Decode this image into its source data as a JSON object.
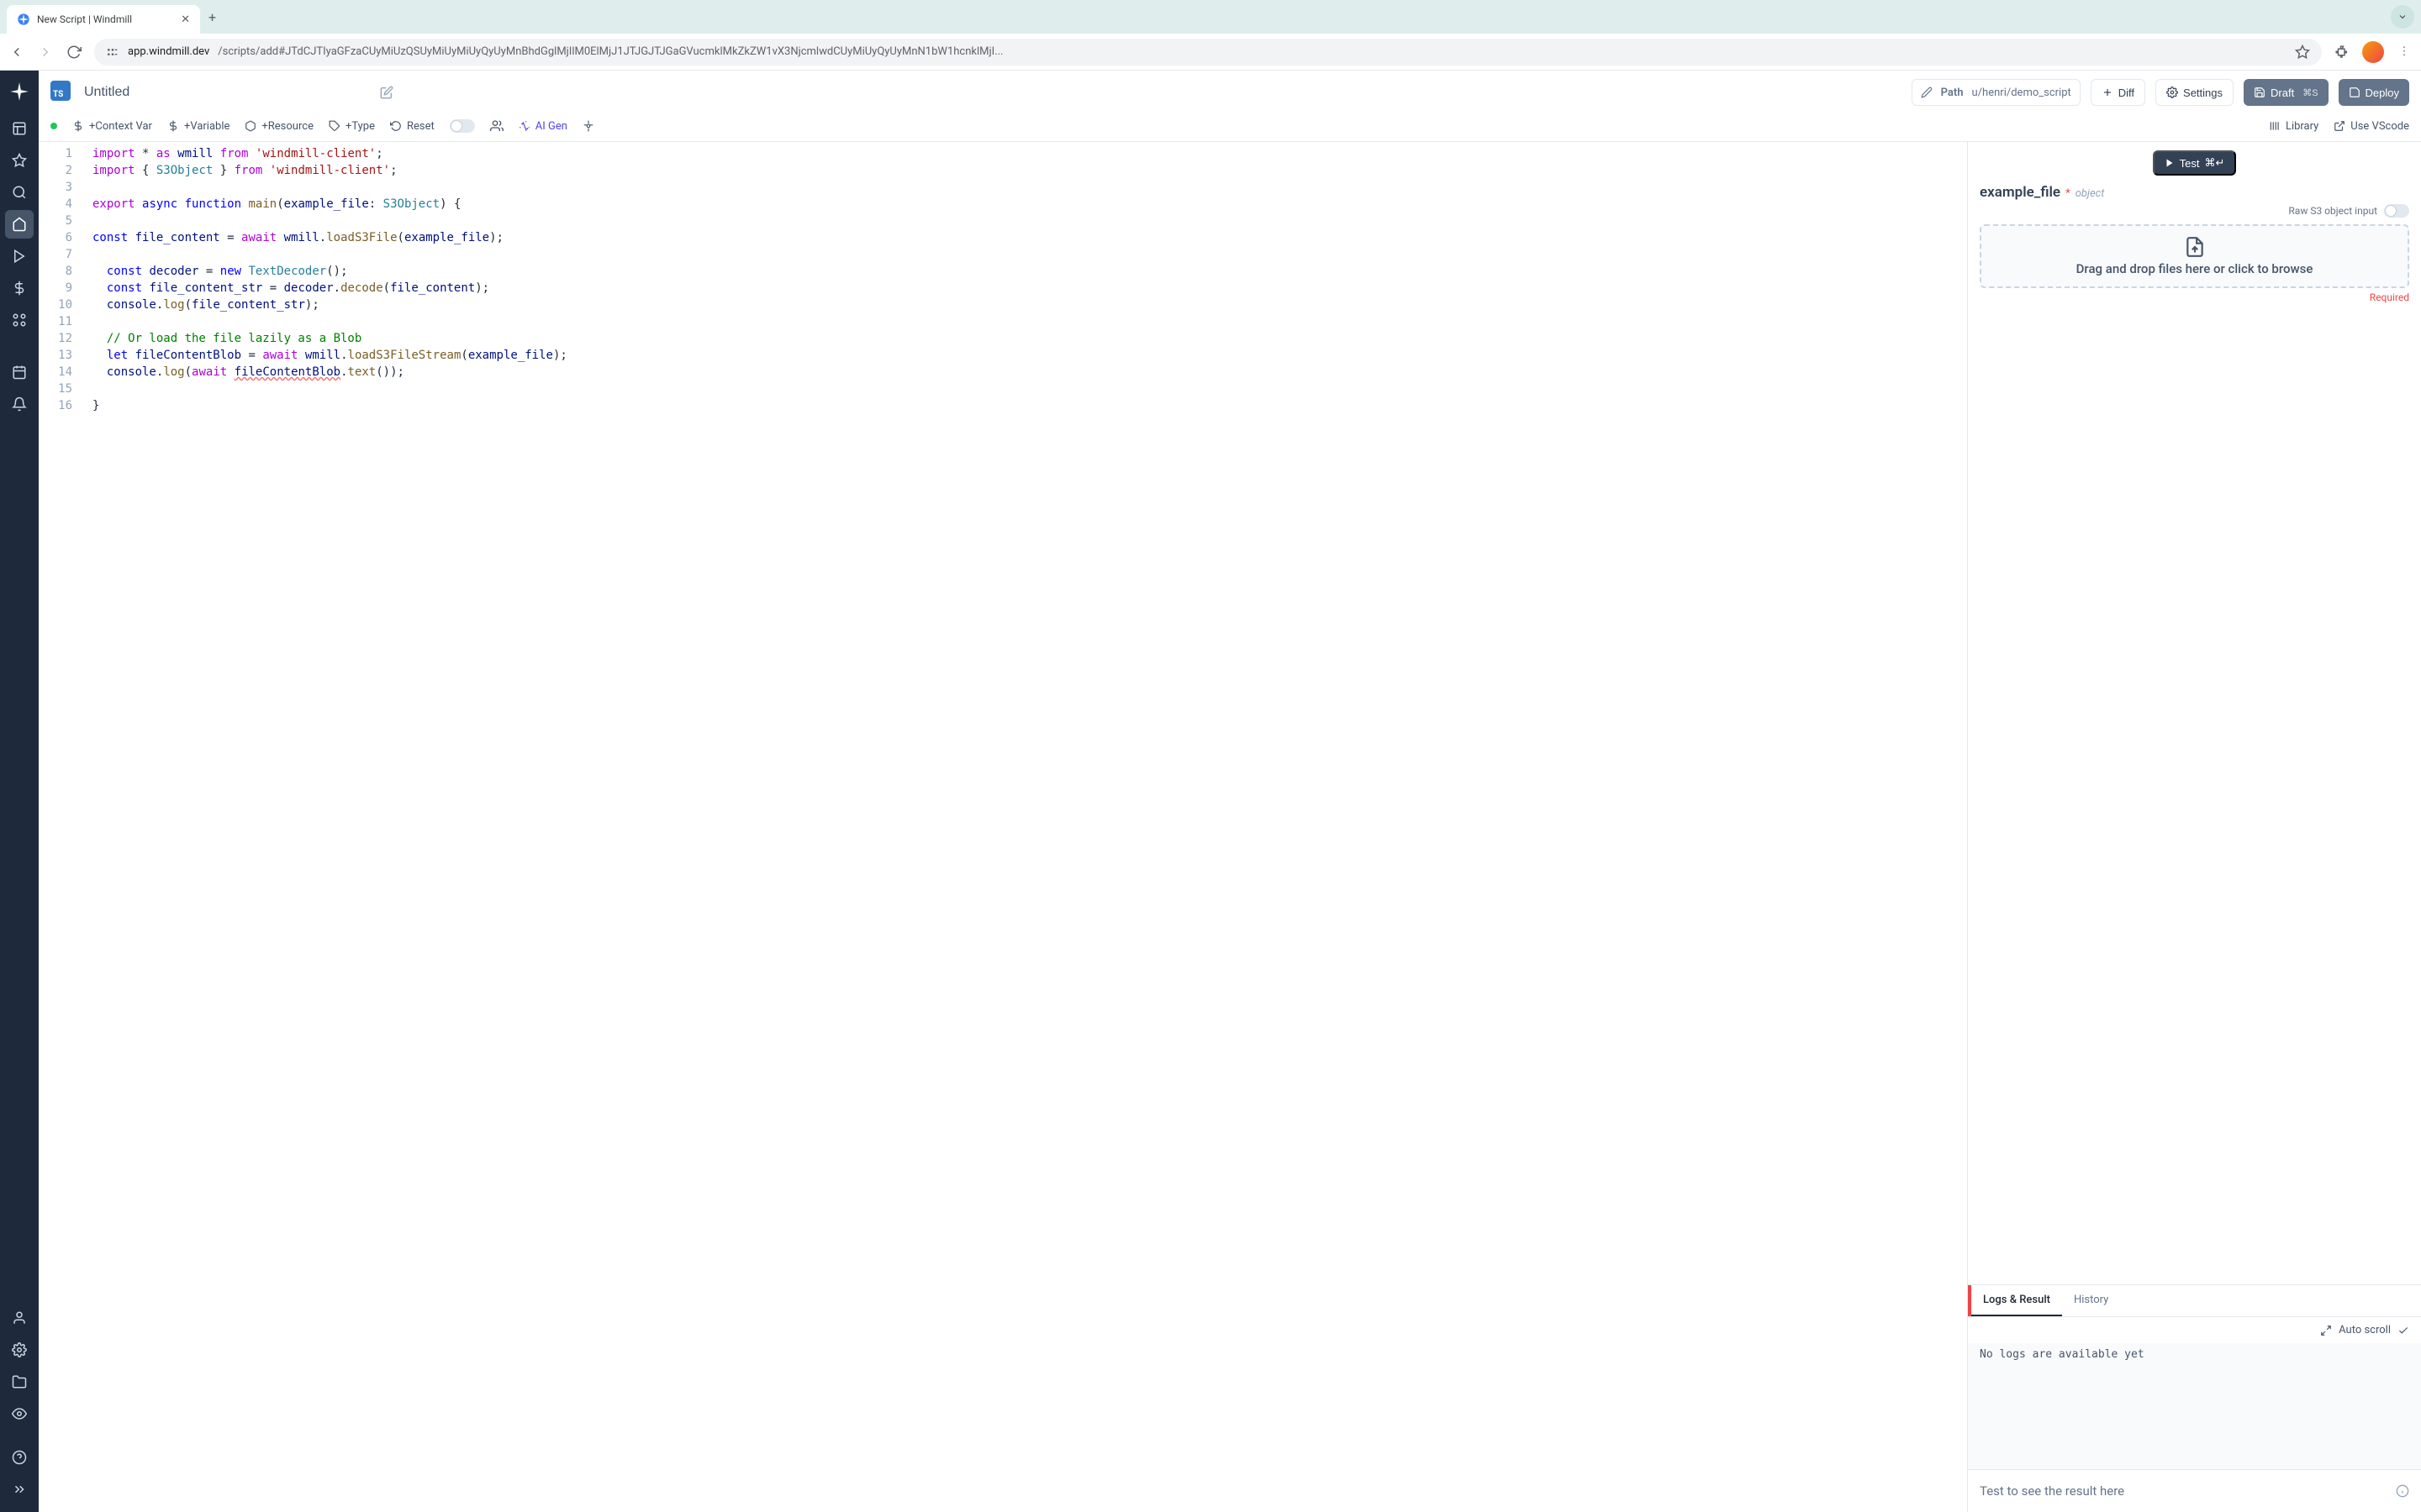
{
  "browser": {
    "tab_title": "New Script | Windmill",
    "url_host": "app.windmill.dev",
    "url_path": "/scripts/add#JTdCJTIyaGFzaCUyMiUzQSUyMiUyMiUyQyUyMnBhdGglMjIlM0ElMjJ1JTJGJTJGaGVucmklMkZkZW1vX3NjcmlwdCUyMiUyQyUyMnN1bW1hcnklMjI..."
  },
  "header": {
    "title": "Untitled",
    "path_label": "Path",
    "path_value": "u/henri/demo_script",
    "diff": "Diff",
    "settings": "Settings",
    "draft": "Draft",
    "draft_kbd": "⌘S",
    "deploy": "Deploy"
  },
  "toolbar": {
    "context_var": "+Context Var",
    "variable": "+Variable",
    "resource": "+Resource",
    "type": "+Type",
    "reset": "Reset",
    "ai_gen": "AI Gen",
    "library": "Library",
    "use_vscode": "Use VScode"
  },
  "editor": {
    "lines": [
      "import * as wmill from 'windmill-client';",
      "import { S3Object } from 'windmill-client';",
      "",
      "export async function main(example_file: S3Object) {",
      "",
      "const file_content = await wmill.loadS3File(example_file);",
      "",
      "  const decoder = new TextDecoder();",
      "  const file_content_str = decoder.decode(file_content);",
      "  console.log(file_content_str);",
      "",
      "  // Or load the file lazily as a Blob",
      "  let fileContentBlob = await wmill.loadS3FileStream(example_file);",
      "  console.log(await fileContentBlob.text());",
      "",
      "}"
    ]
  },
  "right": {
    "test": "Test",
    "test_kbd": "⌘↵",
    "arg_name": "example_file",
    "arg_type": "object",
    "raw_label": "Raw S3 object input",
    "dropzone": "Drag and drop files here or click to browse",
    "required": "Required",
    "tab_logs": "Logs & Result",
    "tab_history": "History",
    "auto_scroll": "Auto scroll",
    "no_logs": "No logs are available yet",
    "result_placeholder": "Test to see the result here"
  }
}
